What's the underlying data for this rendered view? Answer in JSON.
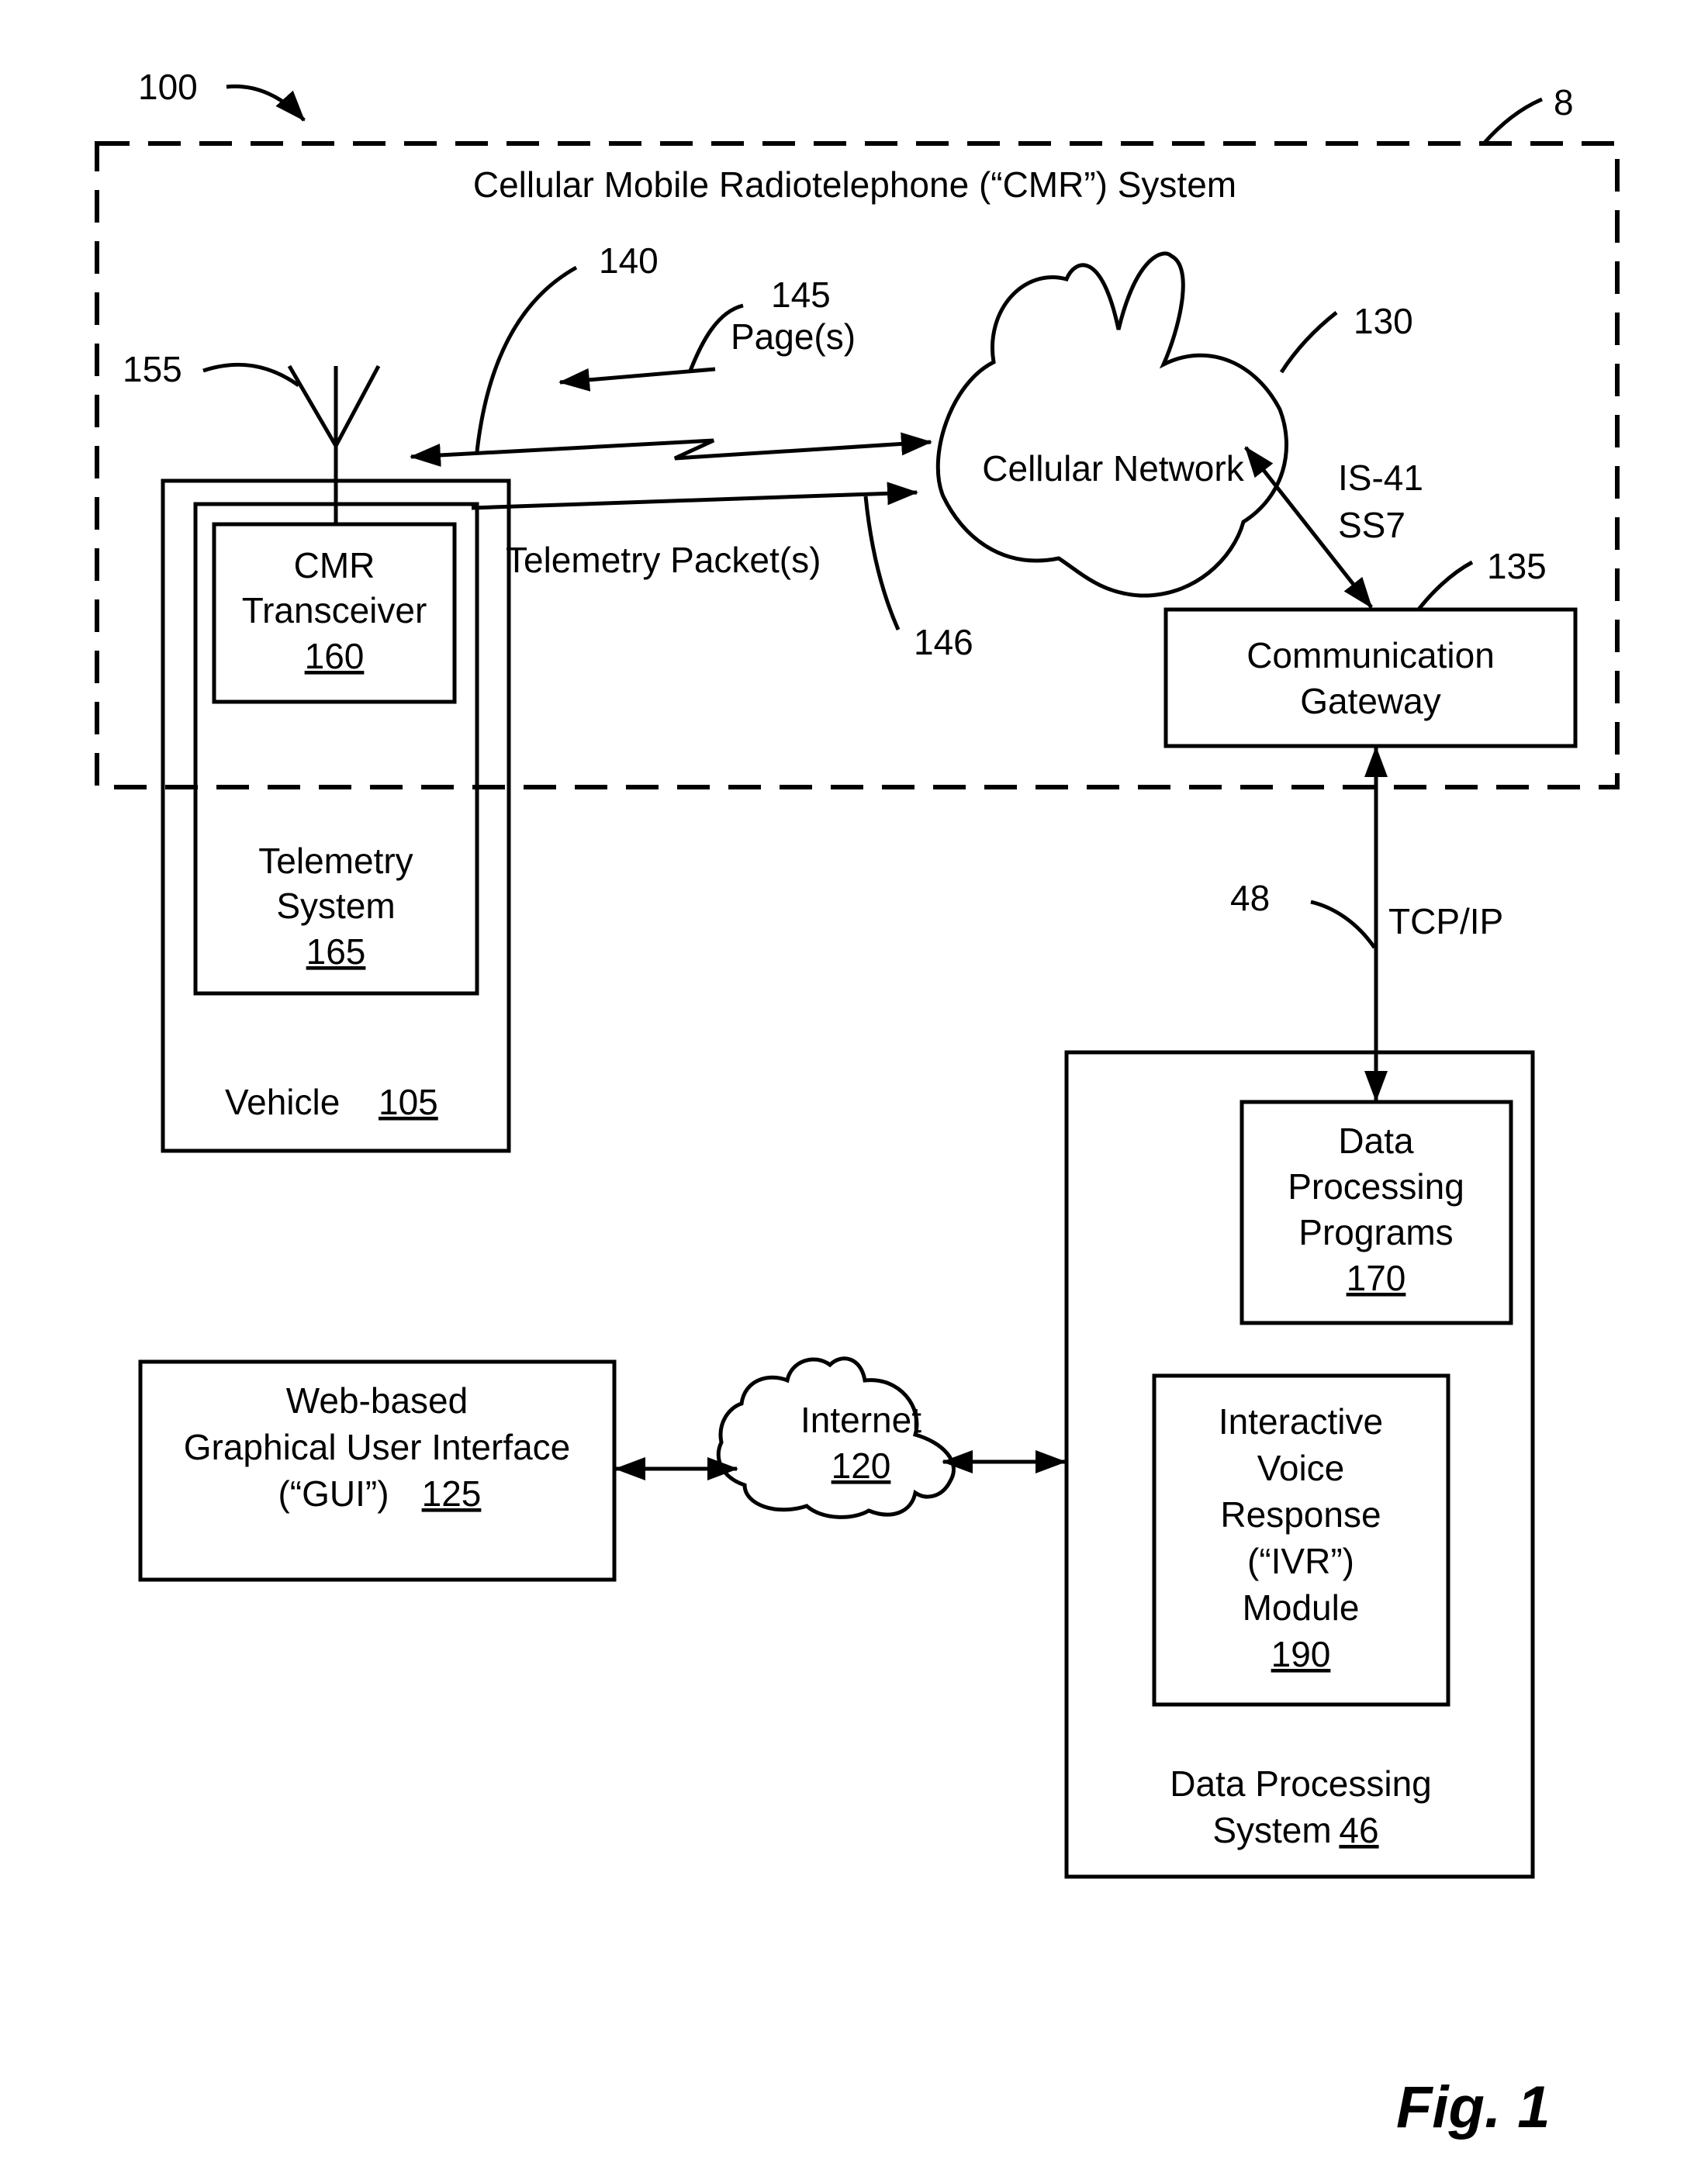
{
  "figure": {
    "label": "Fig. 1",
    "system_ref": "100",
    "cmr_system": {
      "ref": "8",
      "title": "Cellular Mobile Radiotelephone (“CMR”) System"
    },
    "antenna": {
      "ref": "155"
    },
    "vehicle": {
      "label": "Vehicle",
      "ref": "105",
      "telemetry_system": {
        "lines": [
          "Telemetry",
          "System"
        ],
        "ref": "165"
      },
      "cmr_transceiver": {
        "lines": [
          "CMR",
          "Transceiver"
        ],
        "ref": "160"
      }
    },
    "links": {
      "wireless_ref": "140",
      "pages": {
        "ref": "145",
        "label": "Page(s)"
      },
      "telemetry": {
        "ref": "146",
        "label": "Telemetry Packet(s)"
      },
      "signaling": {
        "lines": [
          "IS-41",
          "SS7"
        ]
      },
      "tcpip": {
        "ref": "48",
        "label": "TCP/IP"
      }
    },
    "cellular_network": {
      "label": "Cellular Network",
      "ref": "130"
    },
    "communication_gateway": {
      "lines": [
        "Communication",
        "Gateway"
      ],
      "ref": "135"
    },
    "data_processing_system": {
      "lines": [
        "Data Processing",
        "System"
      ],
      "ref": "46",
      "programs": {
        "lines": [
          "Data",
          "Processing",
          "Programs"
        ],
        "ref": "170"
      },
      "ivr": {
        "lines": [
          "Interactive",
          "Voice",
          "Response",
          "(“IVR”)",
          "Module"
        ],
        "ref": "190"
      }
    },
    "internet": {
      "label": "Internet",
      "ref": "120"
    },
    "gui": {
      "lines": [
        "Web-based",
        "Graphical User Interface"
      ],
      "line3": "(“GUI”)",
      "ref": "125"
    }
  }
}
